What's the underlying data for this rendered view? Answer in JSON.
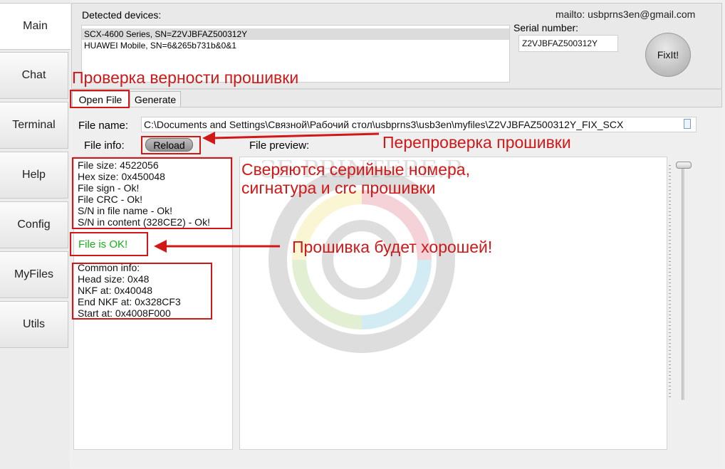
{
  "nav": {
    "items": [
      "Main",
      "Chat",
      "Terminal",
      "Help",
      "Config",
      "MyFiles",
      "Utils"
    ],
    "active": "Main"
  },
  "header": {
    "devices_label": "Detected devices:",
    "devices": [
      "SCX-4600 Series, SN=Z2VJBFAZ500312Y",
      "HUAWEI Mobile, SN=6&265b731b&0&1"
    ],
    "mailto": "mailto: usbprns3en@gmail.com",
    "serial_label": "Serial number:",
    "serial_value": "Z2VJBFAZ500312Y",
    "fixit_label": "FixIt!"
  },
  "tabs": [
    "Open File",
    "Generate"
  ],
  "file": {
    "name_label": "File name:",
    "name_value": "C:\\Documents and Settings\\Связной\\Рабочий стол\\usbprns3\\usb3en\\myfiles\\Z2VJBFAZ500312Y_FIX_SCX",
    "info_label": "File info:",
    "reload_label": "Reload",
    "preview_label": "File preview:",
    "checks": [
      "File size: 4522056",
      "Hex size: 0x450048",
      "File sign - Ok!",
      "File CRC - Ok!",
      "S/N in file name - Ok!",
      "S/N in content (328CE2) - Ok!"
    ],
    "status": "File is OK!",
    "common": [
      "Common info:",
      "Head size: 0x48",
      "NKF at: 0x40048",
      "End NKF at: 0x328CF3",
      "Start at: 0x4008F000"
    ]
  },
  "annotations": {
    "verify": "Проверка верности прошивки",
    "recheck": "Перепроверка прошивки",
    "compare_line1": "Сверяются серийные номера,",
    "compare_line2": "сигнатура и crc прошивки",
    "good": "Прошивка будет хорошей!"
  },
  "watermark_text": "VCE-PRINTERE.RU",
  "colors": {
    "annotation_red": "#d01818",
    "ok_green": "#19b019"
  }
}
